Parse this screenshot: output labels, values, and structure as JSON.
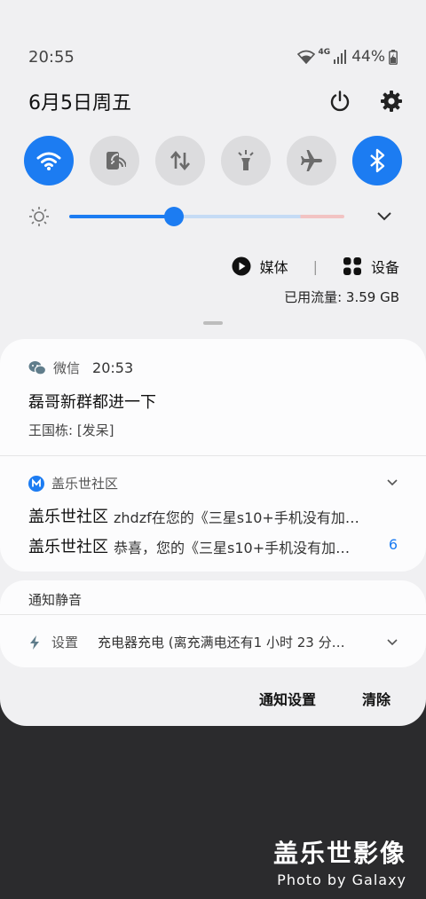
{
  "status_bar": {
    "time": "20:55",
    "network": "4G",
    "battery": "44%"
  },
  "header": {
    "date": "6月5日周五"
  },
  "quick_settings": [
    {
      "name": "wifi",
      "on": true
    },
    {
      "name": "cast",
      "on": false
    },
    {
      "name": "mobile-data",
      "on": false
    },
    {
      "name": "flashlight",
      "on": false
    },
    {
      "name": "airplane",
      "on": false
    },
    {
      "name": "bluetooth",
      "on": true
    }
  ],
  "brightness": {
    "level": 0.38
  },
  "media": {
    "media_label": "媒体",
    "devices_label": "设备"
  },
  "data_usage": "已用流量: 3.59 GB",
  "notifications": {
    "wechat": {
      "app": "微信",
      "time": "20:53",
      "title": "磊哥新群都进一下",
      "text": "王国栋: [发呆]"
    },
    "galaxy": {
      "app": "盖乐世社区",
      "items": [
        {
          "title": "盖乐世社区",
          "body": "zhdzf在您的《三星s10+手机没有加…"
        },
        {
          "title": "盖乐世社区",
          "body": "恭喜，您的《三星s10+手机没有加…",
          "count": "6"
        }
      ]
    }
  },
  "silent": {
    "header": "通知静音",
    "app": "设置",
    "text": "充电器充电 (离充满电还有1 小时 23 分…"
  },
  "actions": {
    "settings": "通知设置",
    "clear": "清除"
  },
  "watermark": {
    "line1": "盖乐世影像",
    "line2": "Photo by Galaxy"
  },
  "colors": {
    "accent": "#1c7cf2",
    "panel": "#f0f0f2",
    "background": "#2b2b2d"
  }
}
